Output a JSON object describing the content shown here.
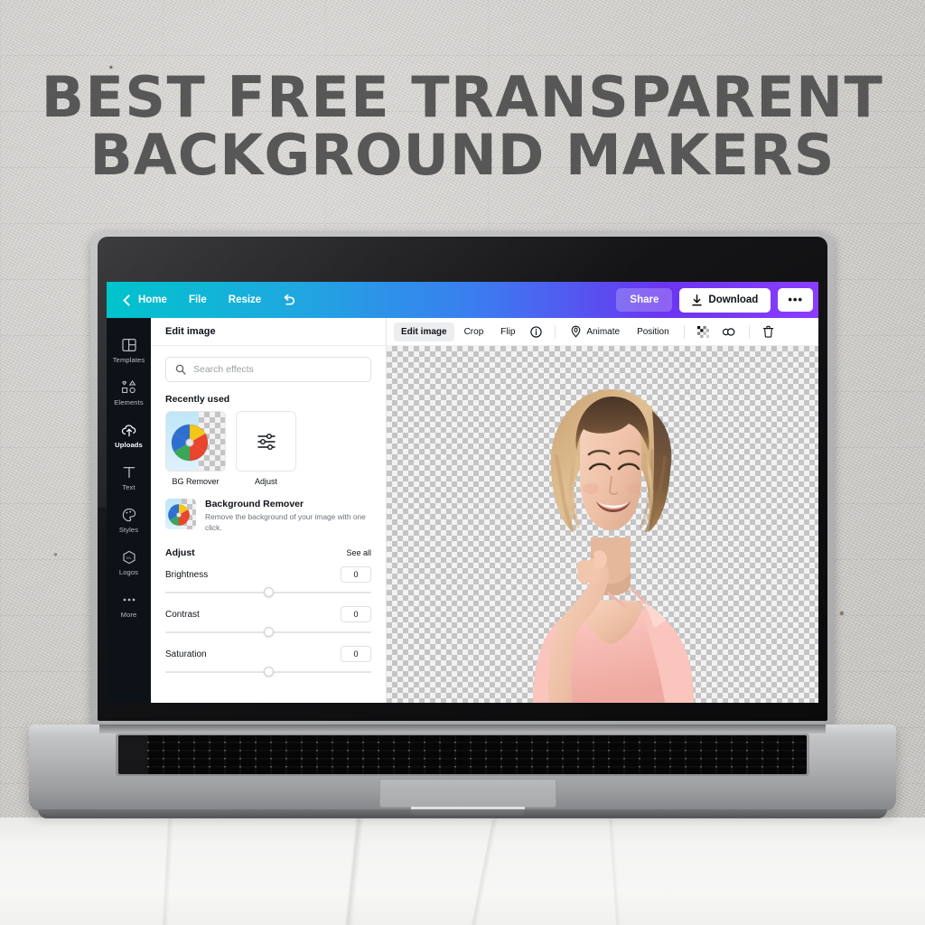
{
  "poster": {
    "headline_line1": "BEST FREE TRANSPARENT",
    "headline_line2": "BACKGROUND MAKERS",
    "headline_color": "#575757",
    "wall_color": "#cfcecb",
    "desk_color": "#f5f5f4"
  },
  "app": {
    "accent_gradient_start": "#00c4cc",
    "accent_gradient_end": "#8b3dff",
    "topbar": {
      "back_icon": "chevron-left-icon",
      "home_label": "Home",
      "file_label": "File",
      "resize_label": "Resize",
      "undo_icon": "undo-arrow-icon",
      "share_label": "Share",
      "download_label": "Download",
      "download_icon": "download-icon",
      "more_label": "•••"
    },
    "sidebar": {
      "items": [
        {
          "label": "Templates",
          "icon": "templates-icon",
          "active": false
        },
        {
          "label": "Elements",
          "icon": "elements-icon",
          "active": false
        },
        {
          "label": "Uploads",
          "icon": "upload-cloud-icon",
          "active": true
        },
        {
          "label": "Text",
          "icon": "text-icon",
          "active": false
        },
        {
          "label": "Styles",
          "icon": "palette-icon",
          "active": false
        },
        {
          "label": "Logos",
          "icon": "logos-icon",
          "active": false
        },
        {
          "label": "More",
          "icon": "ellipsis-icon",
          "active": false
        }
      ]
    },
    "panel": {
      "header": "Edit image",
      "search": {
        "placeholder": "Search effects",
        "value": "",
        "icon": "search-icon"
      },
      "recently_used_title": "Recently used",
      "recent_items": [
        {
          "label": "BG Remover",
          "icon": "beach-ball-thumbnail"
        },
        {
          "label": "Adjust",
          "icon": "sliders-icon"
        }
      ],
      "feature": {
        "title": "Background Remover",
        "description": "Remove the background of your image with one click.",
        "icon": "beach-ball-thumbnail"
      },
      "adjust": {
        "title": "Adjust",
        "see_all_label": "See all",
        "sliders": [
          {
            "name": "Brightness",
            "value": "0",
            "position_pct": 50
          },
          {
            "name": "Contrast",
            "value": "0",
            "position_pct": 50
          },
          {
            "name": "Saturation",
            "value": "0",
            "position_pct": 50
          }
        ]
      }
    },
    "canvas_toolbar": {
      "items": [
        {
          "label": "Edit image",
          "icon": null,
          "selected": true
        },
        {
          "label": "Crop",
          "icon": null,
          "selected": false
        },
        {
          "label": "Flip",
          "icon": null,
          "selected": false
        },
        {
          "label": "",
          "icon": "info-icon",
          "selected": false
        },
        {
          "label": "Animate",
          "icon": "animate-icon",
          "selected": false
        },
        {
          "label": "Position",
          "icon": null,
          "selected": false
        }
      ],
      "right_icons": [
        {
          "icon": "transparency-icon"
        },
        {
          "icon": "duplicate-icon"
        },
        {
          "icon": "trash-icon"
        }
      ]
    },
    "canvas": {
      "background": "transparent-checkerboard",
      "checker_light": "#f2f2f2",
      "checker_dark": "#c4c4c4",
      "subject_description": "Smiling woman with blonde wavy hair in a pink off-shoulder dress, background removed"
    }
  }
}
